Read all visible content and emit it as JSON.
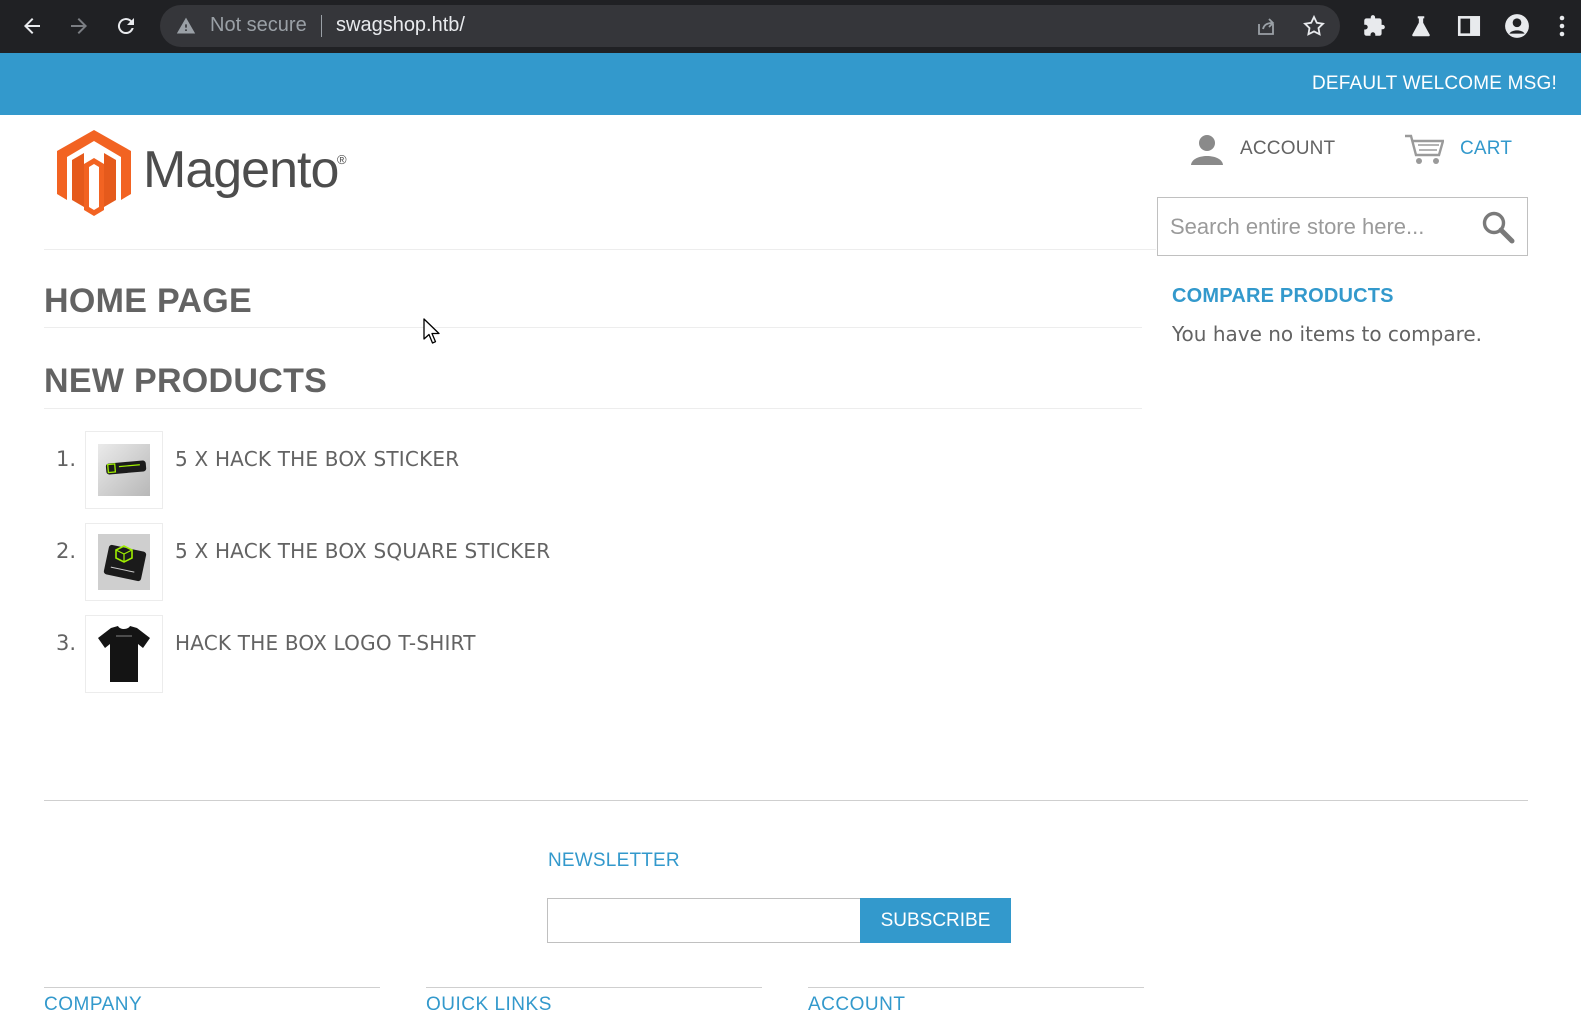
{
  "browser": {
    "security_label": "Not secure",
    "url": "swagshop.htb/"
  },
  "header": {
    "welcome_msg": "DEFAULT WELCOME MSG!",
    "logo_text": "Magento",
    "logo_reg": "®",
    "account_label": "ACCOUNT",
    "cart_label": "CART",
    "search_placeholder": "Search entire store here..."
  },
  "main": {
    "page_title": "HOME PAGE",
    "section_title": "NEW PRODUCTS",
    "products": [
      {
        "num": "1.",
        "name": "5 X HACK THE BOX STICKER"
      },
      {
        "num": "2.",
        "name": "5 X HACK THE BOX SQUARE STICKER"
      },
      {
        "num": "3.",
        "name": "HACK THE BOX LOGO T-SHIRT"
      }
    ]
  },
  "sidebar": {
    "compare_title": "COMPARE PRODUCTS",
    "compare_empty": "You have no items to compare."
  },
  "footer": {
    "newsletter_title": "NEWSLETTER",
    "subscribe_label": "SUBSCRIBE",
    "columns": [
      "COMPANY",
      "QUICK LINKS",
      "ACCOUNT"
    ]
  },
  "colors": {
    "accent": "#3399cc",
    "text": "#636363",
    "chrome": "#202124"
  }
}
